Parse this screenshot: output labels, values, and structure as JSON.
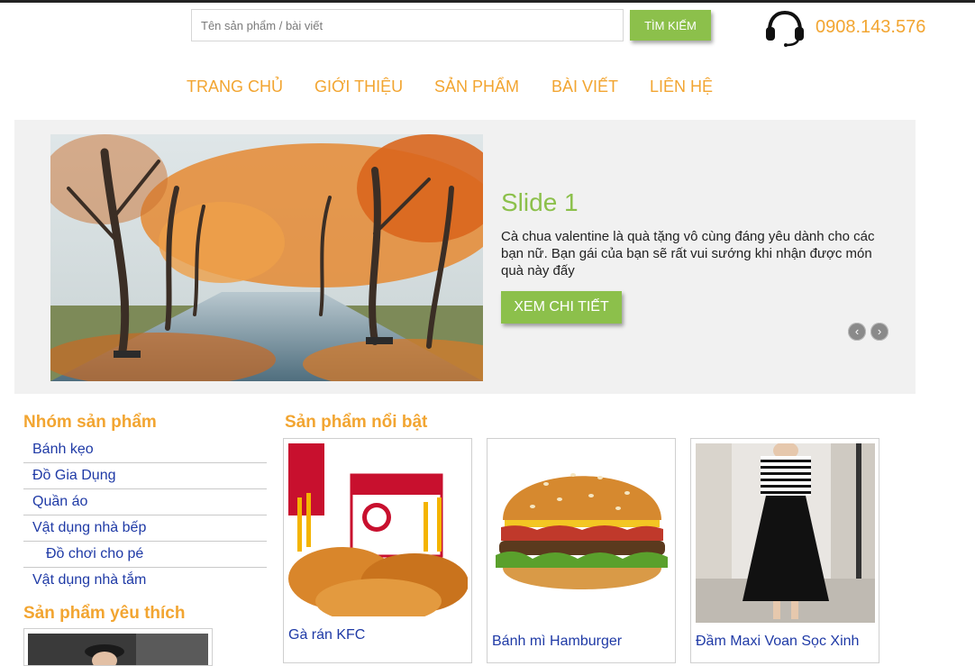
{
  "header": {
    "search_placeholder": "Tên sản phẩm / bài viết",
    "search_value": "",
    "search_button": "TÌM KIẾM",
    "hotline": "0908.143.576"
  },
  "nav": {
    "items": [
      "TRANG CHỦ",
      "GIỚI THIỆU",
      "SẢN PHẨM",
      "BÀI VIẾT",
      "LIÊN HỆ"
    ]
  },
  "slider": {
    "title": "Slide 1",
    "text": "Cà chua valentine là quà tặng vô cùng đáng yêu dành cho các bạn nữ. Bạn gái của bạn sẽ rất vui sướng khi nhận được món quà này đấy",
    "button": "XEM CHI TIẾT",
    "prev": "‹",
    "next": "›"
  },
  "sidebar": {
    "categories_title": "Nhóm sản phẩm",
    "categories": [
      "Bánh kẹo",
      "Đồ Gia Dụng",
      "Quần áo",
      "Vật dụng nhà bếp",
      "Đồ chơi cho pé",
      "Vật dụng nhà tắm"
    ],
    "favorites_title": "Sản phẩm yêu thích"
  },
  "products": {
    "title": "Sản phẩm nổi bật",
    "items": [
      {
        "name": "Gà rán KFC"
      },
      {
        "name": "Bánh mì Hamburger"
      },
      {
        "name": "Đầm Maxi Voan Sọc Xinh"
      }
    ]
  },
  "colors": {
    "accent_green": "#8cc04b",
    "accent_orange": "#f2a531",
    "link_blue": "#1f3aa6",
    "slider_bg": "#f1f1f1"
  }
}
